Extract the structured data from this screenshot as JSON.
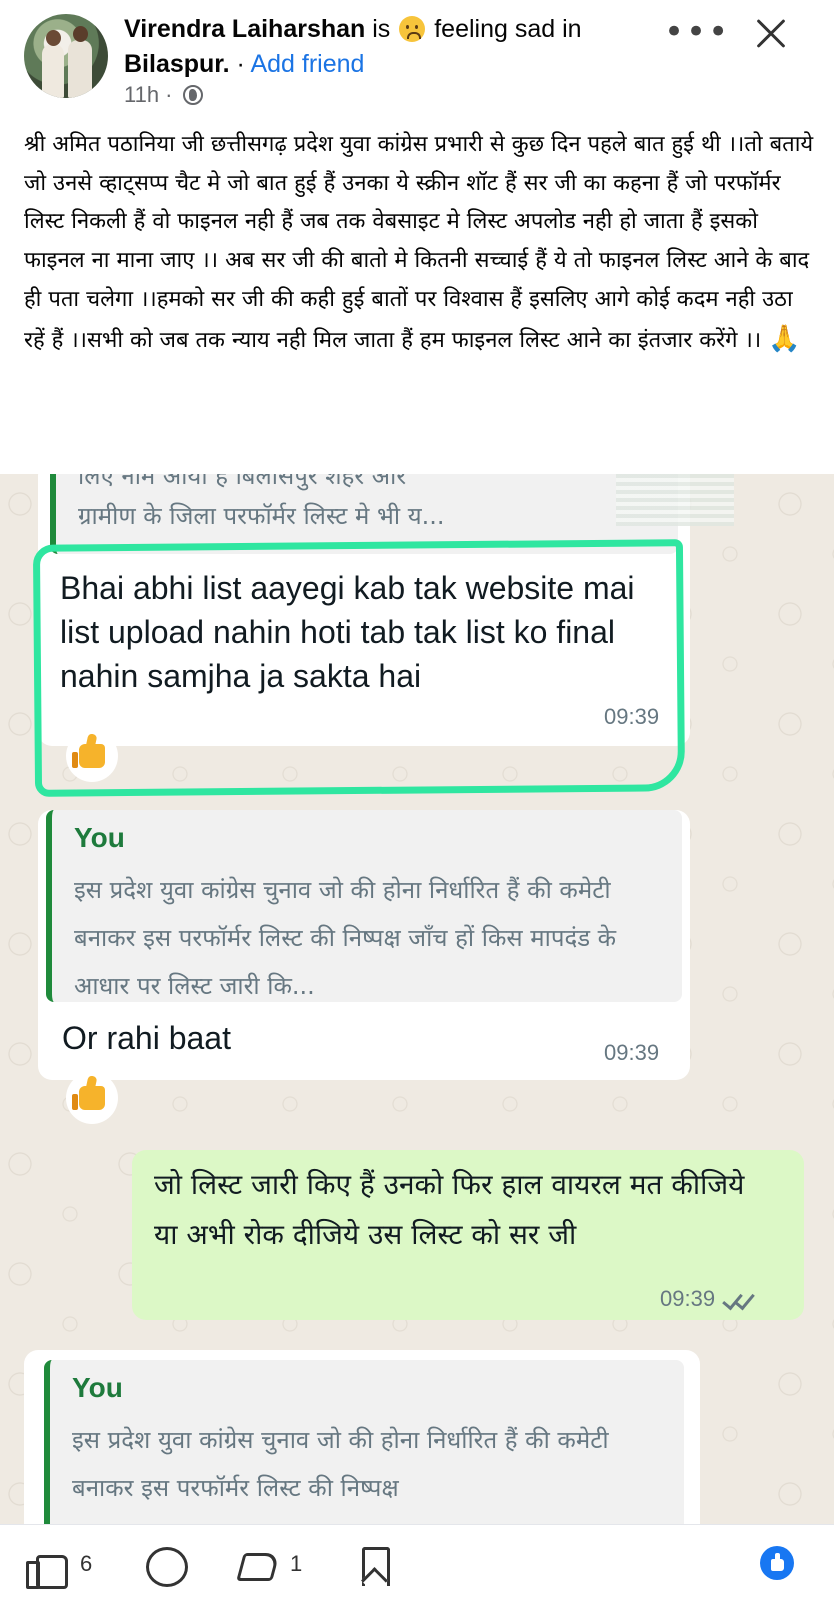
{
  "post": {
    "author": "Virendra Laiharshan",
    "is_word": "is",
    "feeling": "feeling sad in",
    "location": "Bilaspur.",
    "separator": "·",
    "add_friend": "Add friend",
    "time": "11h ·",
    "more_label": "•••",
    "body": "श्री अमित पठानिया जी छत्तीसगढ़ प्रदेश युवा कांग्रेस प्रभारी से कुछ दिन पहले बात हुई थी ।।तो बताये जो उनसे व्हाट्सप्प चैट मे जो बात हुई हैं उनका ये स्क्रीन शॉट हैं सर जी का कहना हैं जो परफॉर्मर लिस्ट निकली हैं वो फाइनल नही हैं जब तक वेबसाइट मे लिस्ट अपलोड नही हो जाता हैं इसको फाइनल ना माना जाए ।। अब सर जी की बातो मे कितनी सच्चाई हैं ये तो फाइनल लिस्ट आने के बाद ही पता चलेगा ।।हमको सर जी की कही हुई बातों पर विश्वास हैं इसलिए आगे कोई कदम नही उठा रहें हैं ।।सभी को जब तक न्याय नही मिल जाता हैं हम फाइनल लिस्ट आने का इंतजार करेंगे ।।",
    "body_emoji": "🙏"
  },
  "chat": {
    "top_quote_line1": "लिए नाम आया है बिलासपुर शहर और",
    "top_quote_line2": "ग्रामीण के जिला परफॉर्मर लिस्ट मे भी य...",
    "msg1": "Bhai abhi list aayegi kab tak website mai list upload nahin hoti tab tak list ko final nahin samjha ja sakta hai",
    "msg1_time": "09:39",
    "quote2_who": "You",
    "quote2_text": "इस प्रदेश युवा कांग्रेस चुनाव जो की होना निर्धारित हैं की   कमेटी बनाकर इस परफॉर्मर लिस्ट की निष्पक्ष जाँच हों किस मापदंड के आधार पर लिस्ट जारी कि...",
    "msg2": "Or rahi baat",
    "msg2_time": "09:39",
    "msg3": "जो लिस्ट जारी किए हैं उनको फिर हाल वायरल मत कीजिये या अभी रोक दीजिये उस लिस्ट को सर जी",
    "msg3_time": "09:39",
    "quote3_who": "You",
    "quote3_text": "इस प्रदेश युवा कांग्रेस चुनाव जो की होना निर्धारित हैं की   कमेटी बनाकर इस परफॉर्मर लिस्ट की निष्पक्ष"
  },
  "actions": {
    "like_count": "6",
    "share_count": "1"
  },
  "colors": {
    "link": "#1b74e4",
    "highlight": "#2fe6a0",
    "outgoing_bubble": "#dcf8c6",
    "quote_bar": "#1f8a3b"
  }
}
